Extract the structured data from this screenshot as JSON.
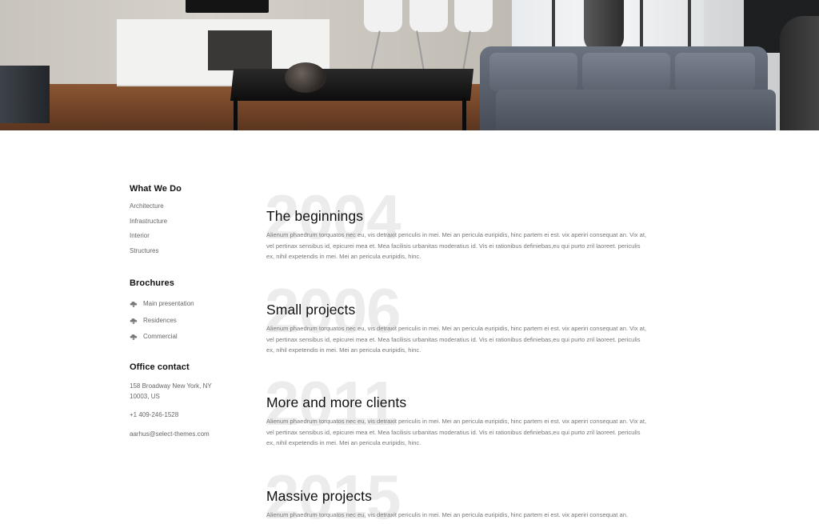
{
  "sidebar": {
    "what_we_do": {
      "heading": "What We Do",
      "links": [
        "Architecture",
        "Infrastructure",
        "Interior",
        "Structures"
      ]
    },
    "brochures": {
      "heading": "Brochures",
      "items": [
        "Main presentation",
        "Residences",
        "Commercial"
      ],
      "icon": "cloud-download-icon"
    },
    "office_contact": {
      "heading": "Office contact",
      "address_line1": "158 Broadway New York, NY",
      "address_line2": "10003, US",
      "phone": "+1 409-246-1528",
      "email": "aarhus@select-themes.com"
    }
  },
  "timeline": [
    {
      "year": "2004",
      "title": "The beginnings",
      "body": "Alienum phaedrum torquatos nec eu, vis detraxit periculis in mei. Mei an pericula euripidis, hinc partem ei est. vix aperiri consequat an. Vix at, vel pertinax sensibus id, epicurei mea et. Mea facilisis urbanitas moderatius id. Vis ei rationibus definiebas,eu qui purto zril laoreet. periculis ex, nihil expetendis in mei. Mei an pericula euripidis, hinc."
    },
    {
      "year": "2006",
      "title": "Small projects",
      "body": "Alienum phaedrum torquatos nec eu, vis detraxit periculis in mei. Mei an pericula euripidis, hinc partem ei est. vix aperiri consequat an. Vix at, vel pertinax sensibus id, epicurei mea et. Mea facilisis urbanitas moderatius id. Vis ei rationibus definiebas,eu qui purto zril laoreet. periculis ex, nihil expetendis in mei. Mei an pericula euripidis, hinc."
    },
    {
      "year": "2011",
      "title": "More and more clients",
      "body": "Alienum phaedrum torquatos nec eu, vis detraxit periculis in mei. Mei an pericula euripidis, hinc partem ei est. vix aperiri consequat an. Vix at, vel pertinax sensibus id, epicurei mea et. Mea facilisis urbanitas moderatius id. Vis ei rationibus definiebas,eu qui purto zril laoreet. periculis ex, nihil expetendis in mei. Mei an pericula euripidis, hinc."
    },
    {
      "year": "2015",
      "title": "Massive projects",
      "body": "Alienum phaedrum torquatos nec eu, vis detraxit periculis in mei. Mei an pericula euripidis, hinc partem ei est. vix aperiri consequat an."
    }
  ],
  "colors": {
    "heading": "#111111",
    "body_text": "#777777",
    "year_watermark": "#ececec",
    "background": "#ffffff"
  }
}
